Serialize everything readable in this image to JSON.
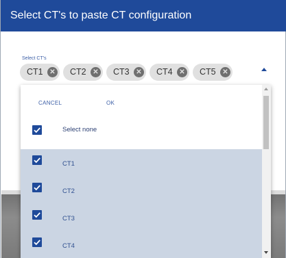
{
  "dialog": {
    "title": "Select CT's to paste CT configuration"
  },
  "field": {
    "label": "Select CT's"
  },
  "chips": [
    {
      "label": "CT1"
    },
    {
      "label": "CT2"
    },
    {
      "label": "CT3"
    },
    {
      "label": "CT4"
    },
    {
      "label": "CT5"
    }
  ],
  "dropdown": {
    "cancel_label": "CANCEL",
    "ok_label": "OK",
    "select_none": {
      "label": "Select none",
      "checked": true
    },
    "options": [
      {
        "label": "CT1",
        "checked": true
      },
      {
        "label": "CT2",
        "checked": true
      },
      {
        "label": "CT3",
        "checked": true
      },
      {
        "label": "CT4",
        "checked": true
      }
    ]
  },
  "colors": {
    "header": "#1f4a9a",
    "accent": "#1f4a9a",
    "selected_row": "#cbd5e3",
    "chip": "#e0e0e0"
  },
  "icons": {
    "chip_remove": "close-circle-icon",
    "checkbox": "checkbox-checked-icon",
    "expand": "caret-up-icon"
  }
}
